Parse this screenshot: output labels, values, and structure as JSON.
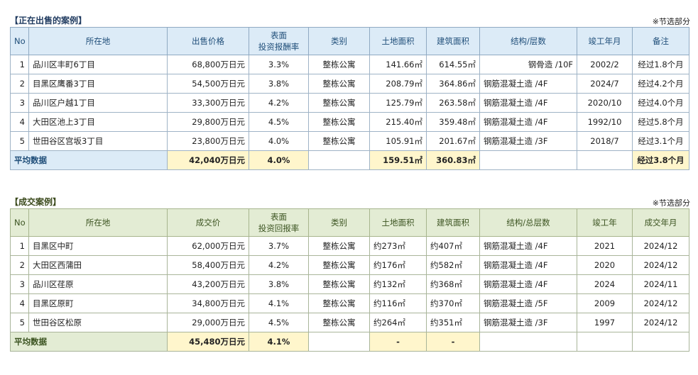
{
  "selling": {
    "title": "【正在出售的案例】",
    "note": "※节选部分",
    "headers": [
      "No",
      "所在地",
      "出售价格",
      "表面",
      "投资报酬率",
      "类别",
      "土地面积",
      "建筑面积",
      "结构/层数",
      "竣工年月",
      "备注"
    ],
    "rows": [
      {
        "no": "1",
        "location": "品川区丰町6丁目",
        "price": "68,800万日元",
        "yield": "3.3%",
        "type": "整栋公寓",
        "land": "141.66㎡",
        "building": "614.55㎡",
        "structure": "钢骨造 /10F",
        "built": "2002/2",
        "remark": "经过1.8个月"
      },
      {
        "no": "2",
        "location": "目黑区鹰番3丁目",
        "price": "54,500万日元",
        "yield": "3.8%",
        "type": "整栋公寓",
        "land": "208.79㎡",
        "building": "364.86㎡",
        "structure": "钢筋混凝土造 /4F",
        "built": "2024/7",
        "remark": "经过4.2个月"
      },
      {
        "no": "3",
        "location": "品川区户越1丁目",
        "price": "33,300万日元",
        "yield": "4.2%",
        "type": "整栋公寓",
        "land": "125.79㎡",
        "building": "263.58㎡",
        "structure": "钢筋混凝土造 /4F",
        "built": "2020/10",
        "remark": "经过4.0个月"
      },
      {
        "no": "4",
        "location": "大田区池上3丁目",
        "price": "29,800万日元",
        "yield": "4.5%",
        "type": "整栋公寓",
        "land": "215.40㎡",
        "building": "359.48㎡",
        "structure": "钢筋混凝土造 /4F",
        "built": "1992/10",
        "remark": "经过5.8个月"
      },
      {
        "no": "5",
        "location": "世田谷区宫坂3丁目",
        "price": "23,800万日元",
        "yield": "4.0%",
        "type": "整栋公寓",
        "land": "105.91㎡",
        "building": "201.67㎡",
        "structure": "钢筋混凝土造 /3F",
        "built": "2018/7",
        "remark": "经过3.1个月"
      }
    ],
    "average": {
      "label": "平均数据",
      "price": "42,040万日元",
      "yield": "4.0%",
      "land": "159.51㎡",
      "building": "360.83㎡",
      "remark": "经过3.8个月"
    }
  },
  "closed": {
    "title": "【成交案例】",
    "note": "※节选部分",
    "headers": [
      "No",
      "所在地",
      "成交价",
      "表面",
      "投资回报率",
      "类别",
      "土地面积",
      "建筑面积",
      "结构/总层数",
      "竣工年",
      "成交年月"
    ],
    "rows": [
      {
        "no": "1",
        "location": "目黑区中町",
        "price": "62,000万日元",
        "yield": "3.7%",
        "type": "整栋公寓",
        "land": "约273㎡",
        "building": "约407㎡",
        "structure": "钢筋混凝土造 /4F",
        "built": "2021",
        "deal": "2024/12"
      },
      {
        "no": "2",
        "location": "大田区西蒲田",
        "price": "58,400万日元",
        "yield": "4.2%",
        "type": "整栋公寓",
        "land": "约176㎡",
        "building": "约582㎡",
        "structure": "钢筋混凝土造 /4F",
        "built": "2020",
        "deal": "2024/12"
      },
      {
        "no": "3",
        "location": "品川区荏原",
        "price": "43,200万日元",
        "yield": "3.8%",
        "type": "整栋公寓",
        "land": "约132㎡",
        "building": "约368㎡",
        "structure": "钢筋混凝土造 /4F",
        "built": "2024",
        "deal": "2024/11"
      },
      {
        "no": "4",
        "location": "目黑区原町",
        "price": "34,800万日元",
        "yield": "4.1%",
        "type": "整栋公寓",
        "land": "约116㎡",
        "building": "约370㎡",
        "structure": "钢筋混凝土造 /5F",
        "built": "2009",
        "deal": "2024/12"
      },
      {
        "no": "5",
        "location": "世田谷区松原",
        "price": "29,000万日元",
        "yield": "4.5%",
        "type": "整栋公寓",
        "land": "约264㎡",
        "building": "约351㎡",
        "structure": "钢筋混凝土造 /3F",
        "built": "1997",
        "deal": "2024/12"
      }
    ],
    "average": {
      "label": "平均数据",
      "price": "45,480万日元",
      "yield": "4.1%",
      "land": "-",
      "building": "-"
    }
  }
}
